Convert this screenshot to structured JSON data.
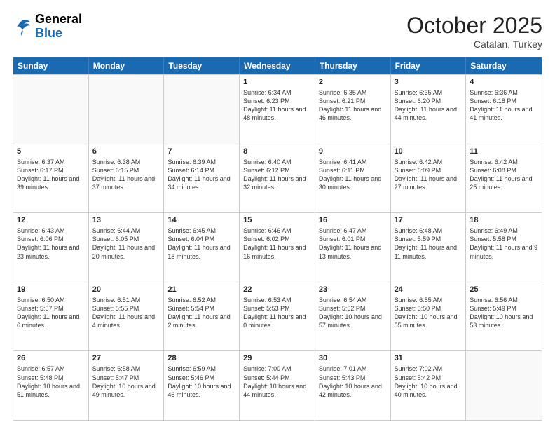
{
  "header": {
    "logo_general": "General",
    "logo_blue": "Blue",
    "month": "October 2025",
    "location": "Catalan, Turkey"
  },
  "days_of_week": [
    "Sunday",
    "Monday",
    "Tuesday",
    "Wednesday",
    "Thursday",
    "Friday",
    "Saturday"
  ],
  "rows": [
    [
      {
        "day": "",
        "info": ""
      },
      {
        "day": "",
        "info": ""
      },
      {
        "day": "",
        "info": ""
      },
      {
        "day": "1",
        "info": "Sunrise: 6:34 AM\nSunset: 6:23 PM\nDaylight: 11 hours\nand 48 minutes."
      },
      {
        "day": "2",
        "info": "Sunrise: 6:35 AM\nSunset: 6:21 PM\nDaylight: 11 hours\nand 46 minutes."
      },
      {
        "day": "3",
        "info": "Sunrise: 6:35 AM\nSunset: 6:20 PM\nDaylight: 11 hours\nand 44 minutes."
      },
      {
        "day": "4",
        "info": "Sunrise: 6:36 AM\nSunset: 6:18 PM\nDaylight: 11 hours\nand 41 minutes."
      }
    ],
    [
      {
        "day": "5",
        "info": "Sunrise: 6:37 AM\nSunset: 6:17 PM\nDaylight: 11 hours\nand 39 minutes."
      },
      {
        "day": "6",
        "info": "Sunrise: 6:38 AM\nSunset: 6:15 PM\nDaylight: 11 hours\nand 37 minutes."
      },
      {
        "day": "7",
        "info": "Sunrise: 6:39 AM\nSunset: 6:14 PM\nDaylight: 11 hours\nand 34 minutes."
      },
      {
        "day": "8",
        "info": "Sunrise: 6:40 AM\nSunset: 6:12 PM\nDaylight: 11 hours\nand 32 minutes."
      },
      {
        "day": "9",
        "info": "Sunrise: 6:41 AM\nSunset: 6:11 PM\nDaylight: 11 hours\nand 30 minutes."
      },
      {
        "day": "10",
        "info": "Sunrise: 6:42 AM\nSunset: 6:09 PM\nDaylight: 11 hours\nand 27 minutes."
      },
      {
        "day": "11",
        "info": "Sunrise: 6:42 AM\nSunset: 6:08 PM\nDaylight: 11 hours\nand 25 minutes."
      }
    ],
    [
      {
        "day": "12",
        "info": "Sunrise: 6:43 AM\nSunset: 6:06 PM\nDaylight: 11 hours\nand 23 minutes."
      },
      {
        "day": "13",
        "info": "Sunrise: 6:44 AM\nSunset: 6:05 PM\nDaylight: 11 hours\nand 20 minutes."
      },
      {
        "day": "14",
        "info": "Sunrise: 6:45 AM\nSunset: 6:04 PM\nDaylight: 11 hours\nand 18 minutes."
      },
      {
        "day": "15",
        "info": "Sunrise: 6:46 AM\nSunset: 6:02 PM\nDaylight: 11 hours\nand 16 minutes."
      },
      {
        "day": "16",
        "info": "Sunrise: 6:47 AM\nSunset: 6:01 PM\nDaylight: 11 hours\nand 13 minutes."
      },
      {
        "day": "17",
        "info": "Sunrise: 6:48 AM\nSunset: 5:59 PM\nDaylight: 11 hours\nand 11 minutes."
      },
      {
        "day": "18",
        "info": "Sunrise: 6:49 AM\nSunset: 5:58 PM\nDaylight: 11 hours\nand 9 minutes."
      }
    ],
    [
      {
        "day": "19",
        "info": "Sunrise: 6:50 AM\nSunset: 5:57 PM\nDaylight: 11 hours\nand 6 minutes."
      },
      {
        "day": "20",
        "info": "Sunrise: 6:51 AM\nSunset: 5:55 PM\nDaylight: 11 hours\nand 4 minutes."
      },
      {
        "day": "21",
        "info": "Sunrise: 6:52 AM\nSunset: 5:54 PM\nDaylight: 11 hours\nand 2 minutes."
      },
      {
        "day": "22",
        "info": "Sunrise: 6:53 AM\nSunset: 5:53 PM\nDaylight: 11 hours\nand 0 minutes."
      },
      {
        "day": "23",
        "info": "Sunrise: 6:54 AM\nSunset: 5:52 PM\nDaylight: 10 hours\nand 57 minutes."
      },
      {
        "day": "24",
        "info": "Sunrise: 6:55 AM\nSunset: 5:50 PM\nDaylight: 10 hours\nand 55 minutes."
      },
      {
        "day": "25",
        "info": "Sunrise: 6:56 AM\nSunset: 5:49 PM\nDaylight: 10 hours\nand 53 minutes."
      }
    ],
    [
      {
        "day": "26",
        "info": "Sunrise: 6:57 AM\nSunset: 5:48 PM\nDaylight: 10 hours\nand 51 minutes."
      },
      {
        "day": "27",
        "info": "Sunrise: 6:58 AM\nSunset: 5:47 PM\nDaylight: 10 hours\nand 49 minutes."
      },
      {
        "day": "28",
        "info": "Sunrise: 6:59 AM\nSunset: 5:46 PM\nDaylight: 10 hours\nand 46 minutes."
      },
      {
        "day": "29",
        "info": "Sunrise: 7:00 AM\nSunset: 5:44 PM\nDaylight: 10 hours\nand 44 minutes."
      },
      {
        "day": "30",
        "info": "Sunrise: 7:01 AM\nSunset: 5:43 PM\nDaylight: 10 hours\nand 42 minutes."
      },
      {
        "day": "31",
        "info": "Sunrise: 7:02 AM\nSunset: 5:42 PM\nDaylight: 10 hours\nand 40 minutes."
      },
      {
        "day": "",
        "info": ""
      }
    ]
  ]
}
